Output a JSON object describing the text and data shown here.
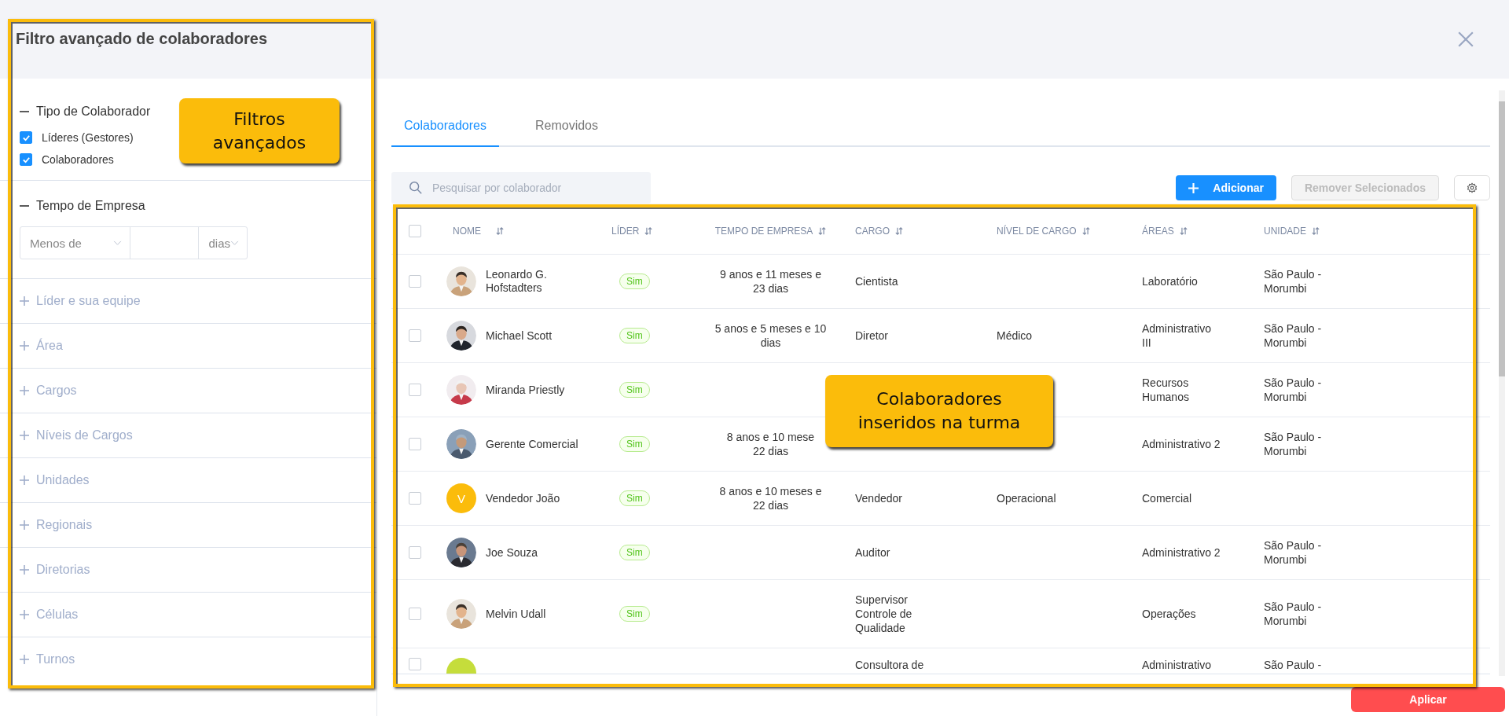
{
  "dialog": {
    "title": "Filtro avançado de colaboradores"
  },
  "filters": [
    {
      "label": "Tipo de Colaborador",
      "expanded": true,
      "kind": "checkboxes",
      "options": [
        {
          "label": "Líderes (Gestores)",
          "checked": true
        },
        {
          "label": "Colaboradores",
          "checked": true
        }
      ]
    },
    {
      "label": "Tempo de Empresa",
      "expanded": true,
      "kind": "duration",
      "comparator": "Menos de",
      "unit": "dias"
    },
    {
      "label": "Líder e sua equipe",
      "expanded": false,
      "kind": "plain"
    },
    {
      "label": "Área",
      "expanded": false,
      "kind": "plain"
    },
    {
      "label": "Cargos",
      "expanded": false,
      "kind": "plain"
    },
    {
      "label": "Níveis de Cargos",
      "expanded": false,
      "kind": "plain"
    },
    {
      "label": "Unidades",
      "expanded": false,
      "kind": "plain"
    },
    {
      "label": "Regionais",
      "expanded": false,
      "kind": "plain"
    },
    {
      "label": "Diretorias",
      "expanded": false,
      "kind": "plain"
    },
    {
      "label": "Células",
      "expanded": false,
      "kind": "plain"
    },
    {
      "label": "Turnos",
      "expanded": false,
      "kind": "plain"
    }
  ],
  "tabs": [
    {
      "label": "Colaboradores",
      "selected": true
    },
    {
      "label": "Removidos",
      "selected": false
    }
  ],
  "search": {
    "placeholder": "Pesquisar por colaborador"
  },
  "buttons": [
    {
      "label": "Adicionar",
      "disabled": false,
      "kind": "add"
    },
    {
      "label": "Remover Selecionados",
      "disabled": true,
      "kind": "remove"
    }
  ],
  "table": {
    "select_all_checked": false,
    "columns": [
      "NOME",
      "LÍDER",
      "TEMPO DE EMPRESA",
      "CARGO",
      "NÍVEL DE CARGO",
      "ÁREAS",
      "UNIDADE"
    ],
    "rows": [
      {
        "checked": false,
        "name": "Leonardo G. Hofstadters",
        "leader": "Sim",
        "tenure": "9 anos e 11 meses e\n23 dias",
        "role": "Cientista",
        "level_name": "",
        "area": "Laboratório",
        "unit": "São Paulo - Morumbi"
      },
      {
        "checked": false,
        "name": "Michael Scott",
        "leader": "Sim",
        "tenure": "5 anos e 5 meses e 10\ndias",
        "role": "Diretor",
        "level_name": "Médico",
        "area": "Administrativo III",
        "unit": "São Paulo - Morumbi"
      },
      {
        "checked": false,
        "name": "Miranda Priestly",
        "leader": "Sim",
        "tenure": "",
        "role": "",
        "level_name": "",
        "area": "Recursos Humanos",
        "unit": "São Paulo - Morumbi"
      },
      {
        "checked": false,
        "name": "Gerente Comercial",
        "leader": "Sim",
        "tenure": "8 anos e 10 mese\n22 dias",
        "role": "",
        "level_name": "",
        "area": "Administrativo 2",
        "unit": "São Paulo - Morumbi"
      },
      {
        "checked": false,
        "avatar": {
          "kind": "initial",
          "letter": "V",
          "color": "#fbbc0b"
        },
        "name": "Vendedor João",
        "leader": "Sim",
        "tenure": "8 anos e 10 meses e\n22 dias",
        "role": "Vendedor",
        "level_name": "Operacional",
        "area": "Comercial",
        "unit": ""
      },
      {
        "checked": false,
        "name": "Joe Souza",
        "leader": "Sim",
        "tenure": "",
        "role": "Auditor",
        "level_name": "",
        "area": "Administrativo 2",
        "unit": "São Paulo - Morumbi"
      },
      {
        "checked": false,
        "name": "Melvin Udall",
        "leader": "Sim",
        "tenure": "",
        "role": "Supervisor Controle de Qualidade",
        "level_name": "",
        "area": "Operações",
        "unit": "São Paulo - Morumbi"
      },
      {
        "checked": false,
        "avatar": {
          "kind": "blank",
          "color": "#c5dd3b"
        },
        "name": "",
        "leader": "",
        "tenure": "",
        "role": "Consultora de",
        "level_name": "",
        "area": "Administrativo",
        "unit": "São Paulo -"
      }
    ]
  },
  "apply_button": {
    "label": "Aplicar"
  },
  "callouts": [
    {
      "text": "Filtros avançados"
    },
    {
      "text": "Colaboradores inseridos na turma"
    }
  ]
}
